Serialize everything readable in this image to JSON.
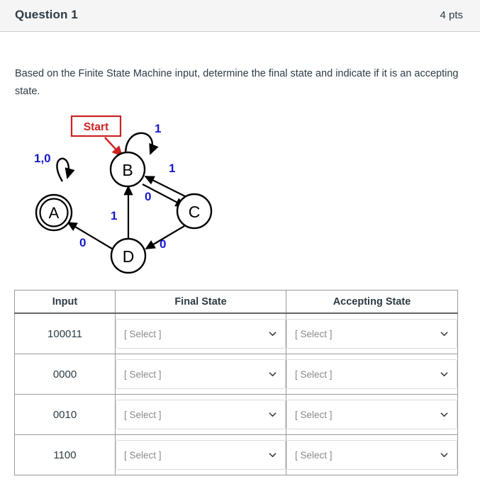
{
  "header": {
    "title": "Question 1",
    "points": "4 pts"
  },
  "prompt": {
    "text": "Based on the Finite State Machine input, determine the final state and indicate if it is an accepting state."
  },
  "diagram": {
    "start_label": "Start",
    "states": [
      {
        "name": "A",
        "accepting": true
      },
      {
        "name": "B",
        "accepting": false
      },
      {
        "name": "C",
        "accepting": false
      },
      {
        "name": "D",
        "accepting": false
      }
    ],
    "transition_labels": {
      "a_self": "1,0",
      "b_self": "1",
      "c_to_b": "1",
      "b_to_c": "0",
      "d_to_b": "1",
      "c_to_d": "0",
      "d_to_a": "0"
    },
    "colors": {
      "label": "#1818d0",
      "start": "#cc2222",
      "state": "#000000"
    }
  },
  "table": {
    "columns": [
      "Input",
      "Final State",
      "Accepting State"
    ],
    "rows": [
      {
        "input": "100011",
        "final_state": "[ Select ]",
        "accepting_state": "[ Select ]"
      },
      {
        "input": "0000",
        "final_state": "[ Select ]",
        "accepting_state": "[ Select ]"
      },
      {
        "input": "0010",
        "final_state": "[ Select ]",
        "accepting_state": "[ Select ]"
      },
      {
        "input": "1100",
        "final_state": "[ Select ]",
        "accepting_state": "[ Select ]"
      }
    ]
  }
}
